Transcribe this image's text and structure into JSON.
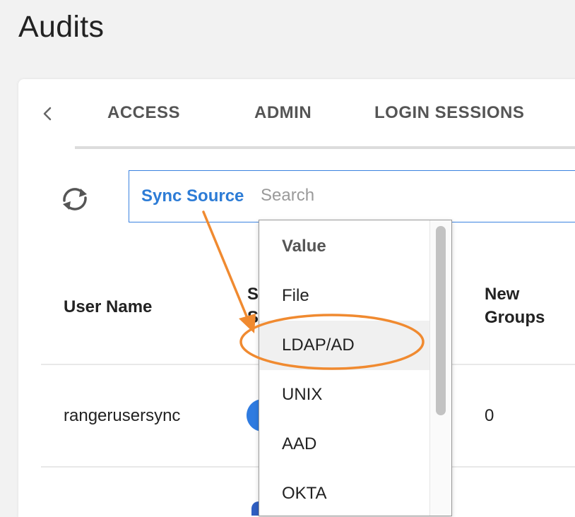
{
  "page": {
    "title": "Audits"
  },
  "tabs": [
    {
      "label": "ACCESS"
    },
    {
      "label": "ADMIN"
    },
    {
      "label": "LOGIN SESSIONS"
    }
  ],
  "search": {
    "filter_label": "Sync Source",
    "placeholder": "Search",
    "value": ""
  },
  "table": {
    "headers": {
      "user_name": "User Name",
      "sync_source_partial_1": "S",
      "sync_source_partial_2": "S",
      "new_groups_line1": "New",
      "new_groups_line2": "Groups"
    },
    "rows": [
      {
        "user_name": "rangerusersync",
        "new_groups": "0"
      }
    ]
  },
  "dropdown": {
    "header": "Value",
    "options": [
      "File",
      "LDAP/AD",
      "UNIX",
      "AAD",
      "OKTA"
    ],
    "highlighted": "LDAP/AD"
  },
  "colors": {
    "accent": "#3b82e0",
    "filter_text": "#2d7cd6",
    "annotation": "#f08a30"
  },
  "icons": {
    "tab_prev": "chevron-left-icon",
    "refresh": "refresh-icon"
  }
}
